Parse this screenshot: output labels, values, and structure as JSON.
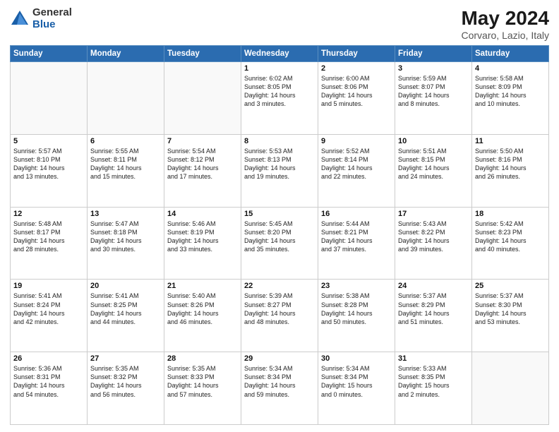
{
  "logo": {
    "general": "General",
    "blue": "Blue"
  },
  "title": "May 2024",
  "subtitle": "Corvaro, Lazio, Italy",
  "days": [
    "Sunday",
    "Monday",
    "Tuesday",
    "Wednesday",
    "Thursday",
    "Friday",
    "Saturday"
  ],
  "weeks": [
    [
      {
        "day": "",
        "lines": []
      },
      {
        "day": "",
        "lines": []
      },
      {
        "day": "",
        "lines": []
      },
      {
        "day": "1",
        "lines": [
          "Sunrise: 6:02 AM",
          "Sunset: 8:05 PM",
          "Daylight: 14 hours",
          "and 3 minutes."
        ]
      },
      {
        "day": "2",
        "lines": [
          "Sunrise: 6:00 AM",
          "Sunset: 8:06 PM",
          "Daylight: 14 hours",
          "and 5 minutes."
        ]
      },
      {
        "day": "3",
        "lines": [
          "Sunrise: 5:59 AM",
          "Sunset: 8:07 PM",
          "Daylight: 14 hours",
          "and 8 minutes."
        ]
      },
      {
        "day": "4",
        "lines": [
          "Sunrise: 5:58 AM",
          "Sunset: 8:09 PM",
          "Daylight: 14 hours",
          "and 10 minutes."
        ]
      }
    ],
    [
      {
        "day": "5",
        "lines": [
          "Sunrise: 5:57 AM",
          "Sunset: 8:10 PM",
          "Daylight: 14 hours",
          "and 13 minutes."
        ]
      },
      {
        "day": "6",
        "lines": [
          "Sunrise: 5:55 AM",
          "Sunset: 8:11 PM",
          "Daylight: 14 hours",
          "and 15 minutes."
        ]
      },
      {
        "day": "7",
        "lines": [
          "Sunrise: 5:54 AM",
          "Sunset: 8:12 PM",
          "Daylight: 14 hours",
          "and 17 minutes."
        ]
      },
      {
        "day": "8",
        "lines": [
          "Sunrise: 5:53 AM",
          "Sunset: 8:13 PM",
          "Daylight: 14 hours",
          "and 19 minutes."
        ]
      },
      {
        "day": "9",
        "lines": [
          "Sunrise: 5:52 AM",
          "Sunset: 8:14 PM",
          "Daylight: 14 hours",
          "and 22 minutes."
        ]
      },
      {
        "day": "10",
        "lines": [
          "Sunrise: 5:51 AM",
          "Sunset: 8:15 PM",
          "Daylight: 14 hours",
          "and 24 minutes."
        ]
      },
      {
        "day": "11",
        "lines": [
          "Sunrise: 5:50 AM",
          "Sunset: 8:16 PM",
          "Daylight: 14 hours",
          "and 26 minutes."
        ]
      }
    ],
    [
      {
        "day": "12",
        "lines": [
          "Sunrise: 5:48 AM",
          "Sunset: 8:17 PM",
          "Daylight: 14 hours",
          "and 28 minutes."
        ]
      },
      {
        "day": "13",
        "lines": [
          "Sunrise: 5:47 AM",
          "Sunset: 8:18 PM",
          "Daylight: 14 hours",
          "and 30 minutes."
        ]
      },
      {
        "day": "14",
        "lines": [
          "Sunrise: 5:46 AM",
          "Sunset: 8:19 PM",
          "Daylight: 14 hours",
          "and 33 minutes."
        ]
      },
      {
        "day": "15",
        "lines": [
          "Sunrise: 5:45 AM",
          "Sunset: 8:20 PM",
          "Daylight: 14 hours",
          "and 35 minutes."
        ]
      },
      {
        "day": "16",
        "lines": [
          "Sunrise: 5:44 AM",
          "Sunset: 8:21 PM",
          "Daylight: 14 hours",
          "and 37 minutes."
        ]
      },
      {
        "day": "17",
        "lines": [
          "Sunrise: 5:43 AM",
          "Sunset: 8:22 PM",
          "Daylight: 14 hours",
          "and 39 minutes."
        ]
      },
      {
        "day": "18",
        "lines": [
          "Sunrise: 5:42 AM",
          "Sunset: 8:23 PM",
          "Daylight: 14 hours",
          "and 40 minutes."
        ]
      }
    ],
    [
      {
        "day": "19",
        "lines": [
          "Sunrise: 5:41 AM",
          "Sunset: 8:24 PM",
          "Daylight: 14 hours",
          "and 42 minutes."
        ]
      },
      {
        "day": "20",
        "lines": [
          "Sunrise: 5:41 AM",
          "Sunset: 8:25 PM",
          "Daylight: 14 hours",
          "and 44 minutes."
        ]
      },
      {
        "day": "21",
        "lines": [
          "Sunrise: 5:40 AM",
          "Sunset: 8:26 PM",
          "Daylight: 14 hours",
          "and 46 minutes."
        ]
      },
      {
        "day": "22",
        "lines": [
          "Sunrise: 5:39 AM",
          "Sunset: 8:27 PM",
          "Daylight: 14 hours",
          "and 48 minutes."
        ]
      },
      {
        "day": "23",
        "lines": [
          "Sunrise: 5:38 AM",
          "Sunset: 8:28 PM",
          "Daylight: 14 hours",
          "and 50 minutes."
        ]
      },
      {
        "day": "24",
        "lines": [
          "Sunrise: 5:37 AM",
          "Sunset: 8:29 PM",
          "Daylight: 14 hours",
          "and 51 minutes."
        ]
      },
      {
        "day": "25",
        "lines": [
          "Sunrise: 5:37 AM",
          "Sunset: 8:30 PM",
          "Daylight: 14 hours",
          "and 53 minutes."
        ]
      }
    ],
    [
      {
        "day": "26",
        "lines": [
          "Sunrise: 5:36 AM",
          "Sunset: 8:31 PM",
          "Daylight: 14 hours",
          "and 54 minutes."
        ]
      },
      {
        "day": "27",
        "lines": [
          "Sunrise: 5:35 AM",
          "Sunset: 8:32 PM",
          "Daylight: 14 hours",
          "and 56 minutes."
        ]
      },
      {
        "day": "28",
        "lines": [
          "Sunrise: 5:35 AM",
          "Sunset: 8:33 PM",
          "Daylight: 14 hours",
          "and 57 minutes."
        ]
      },
      {
        "day": "29",
        "lines": [
          "Sunrise: 5:34 AM",
          "Sunset: 8:34 PM",
          "Daylight: 14 hours",
          "and 59 minutes."
        ]
      },
      {
        "day": "30",
        "lines": [
          "Sunrise: 5:34 AM",
          "Sunset: 8:34 PM",
          "Daylight: 15 hours",
          "and 0 minutes."
        ]
      },
      {
        "day": "31",
        "lines": [
          "Sunrise: 5:33 AM",
          "Sunset: 8:35 PM",
          "Daylight: 15 hours",
          "and 2 minutes."
        ]
      },
      {
        "day": "",
        "lines": []
      }
    ]
  ]
}
